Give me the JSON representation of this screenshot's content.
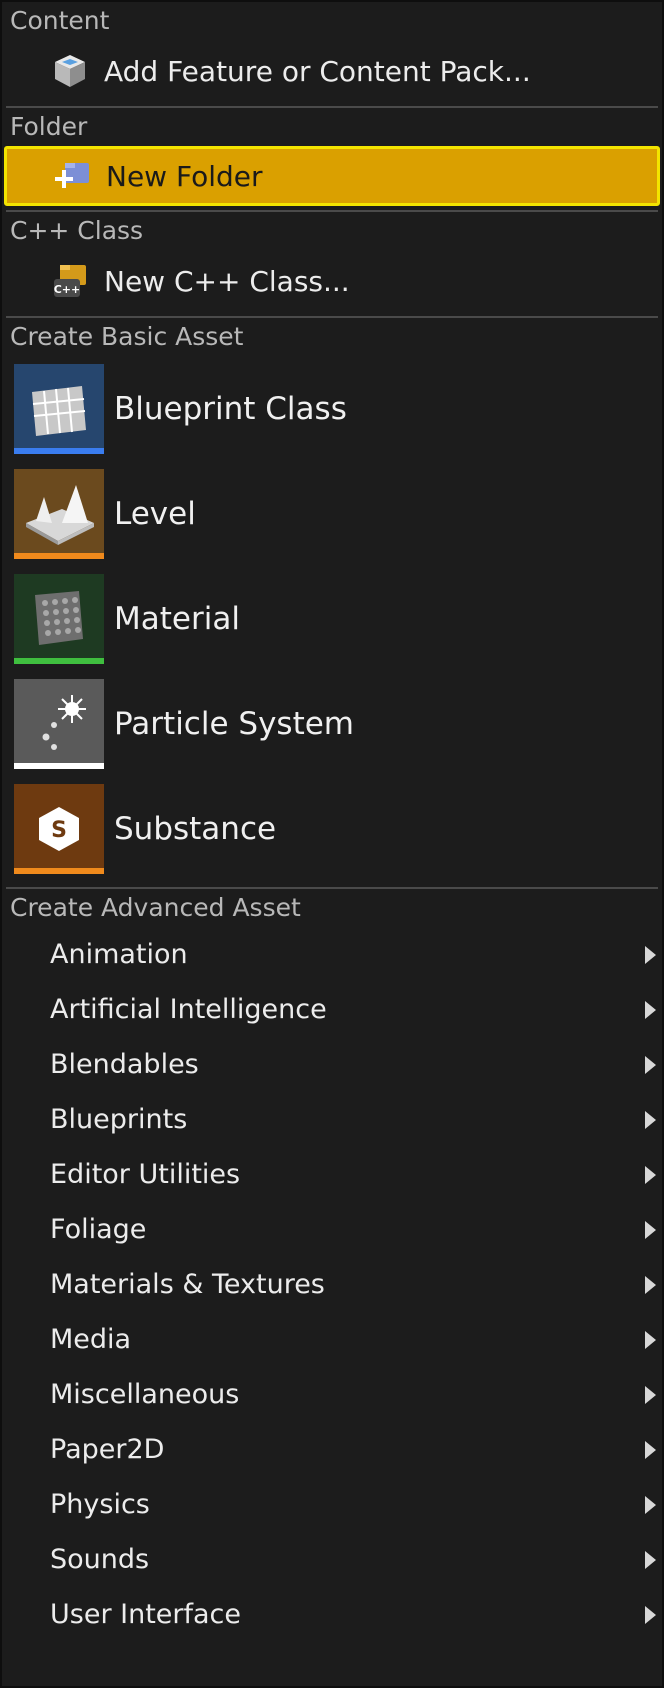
{
  "sections": {
    "content": {
      "header": "Content",
      "item": {
        "label": "Add Feature or Content Pack...",
        "icon": "cube-package-icon"
      }
    },
    "folder": {
      "header": "Folder",
      "item": {
        "label": "New Folder",
        "icon": "new-folder-icon"
      }
    },
    "cpp": {
      "header": "C++ Class",
      "item": {
        "label": "New C++ Class...",
        "icon": "cpp-class-icon"
      }
    },
    "basic": {
      "header": "Create Basic Asset",
      "items": [
        {
          "label": "Blueprint Class",
          "icon": "blueprint-icon",
          "bar_color": "#3a7df0"
        },
        {
          "label": "Level",
          "icon": "level-icon",
          "bar_color": "#f08a1c"
        },
        {
          "label": "Material",
          "icon": "material-icon",
          "bar_color": "#3fbf3f"
        },
        {
          "label": "Particle System",
          "icon": "particle-system-icon",
          "bar_color": "#ffffff"
        },
        {
          "label": "Substance",
          "icon": "substance-icon",
          "bar_color": "#f08a1c"
        }
      ]
    },
    "advanced": {
      "header": "Create Advanced Asset",
      "items": [
        {
          "label": "Animation"
        },
        {
          "label": "Artificial Intelligence"
        },
        {
          "label": "Blendables"
        },
        {
          "label": "Blueprints"
        },
        {
          "label": "Editor Utilities"
        },
        {
          "label": "Foliage"
        },
        {
          "label": "Materials & Textures"
        },
        {
          "label": "Media"
        },
        {
          "label": "Miscellaneous"
        },
        {
          "label": "Paper2D"
        },
        {
          "label": "Physics"
        },
        {
          "label": "Sounds"
        },
        {
          "label": "User Interface"
        }
      ]
    }
  },
  "colors": {
    "highlight": "#daa000",
    "highlight_border": "#f3e400",
    "background": "#1c1c1c"
  }
}
